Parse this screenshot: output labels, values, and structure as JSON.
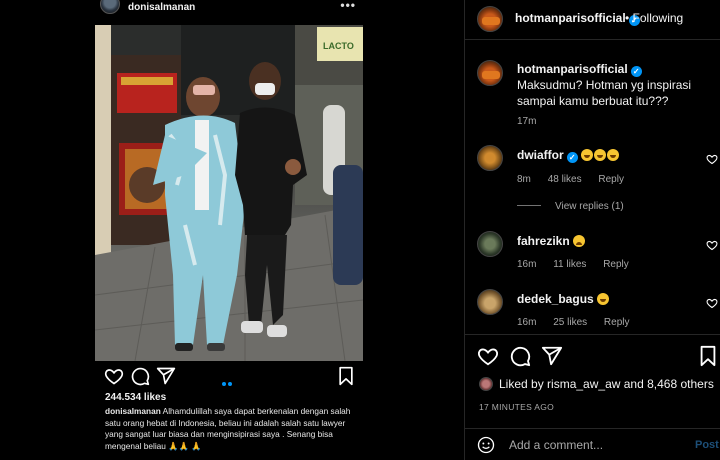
{
  "embedded_post": {
    "username": "donisalmanan",
    "more_label": "•••",
    "likes": "244.534 likes",
    "caption_user": "donisalmanan",
    "caption_text": "Alhamdulillah saya dapat berkenalan dengan salah satu orang hebat di Indonesia, beliau ini adalah salah satu lawyer yang sangat luar biasa dan menginsipirasi saya . Senang bisa mengenal beliau 🙏🙏 🙏",
    "store_sign": "LACTO"
  },
  "header": {
    "username": "hotmanparisofficial",
    "verified_mark": "✓",
    "follow_label": "• Following",
    "more_label": "•••"
  },
  "comments": [
    {
      "username": "hotmanparisofficial",
      "text": "Maksudmu? Hotman yg inspirasi sampai kamu berbuat itu???",
      "time": "17m"
    },
    {
      "username": "dwiaffor",
      "time": "8m",
      "likes": "48 likes",
      "reply": "Reply",
      "view_replies": "View replies (1)"
    },
    {
      "username": "fahrezikn",
      "time": "16m",
      "likes": "11 likes",
      "reply": "Reply"
    },
    {
      "username": "dedek_bagus",
      "time": "16m",
      "likes": "25 likes",
      "reply": "Reply"
    }
  ],
  "liked_by": {
    "prefix": "Liked by",
    "user": "risma_aw_aw",
    "suffix": "and 8,468 others"
  },
  "timestamp": "17 MINUTES AGO",
  "add_comment": {
    "placeholder": "Add a comment...",
    "post_label": "Post"
  },
  "colors": {
    "accent": "#0095f6",
    "background": "#000000",
    "secondary_text": "#a8a8a8"
  }
}
